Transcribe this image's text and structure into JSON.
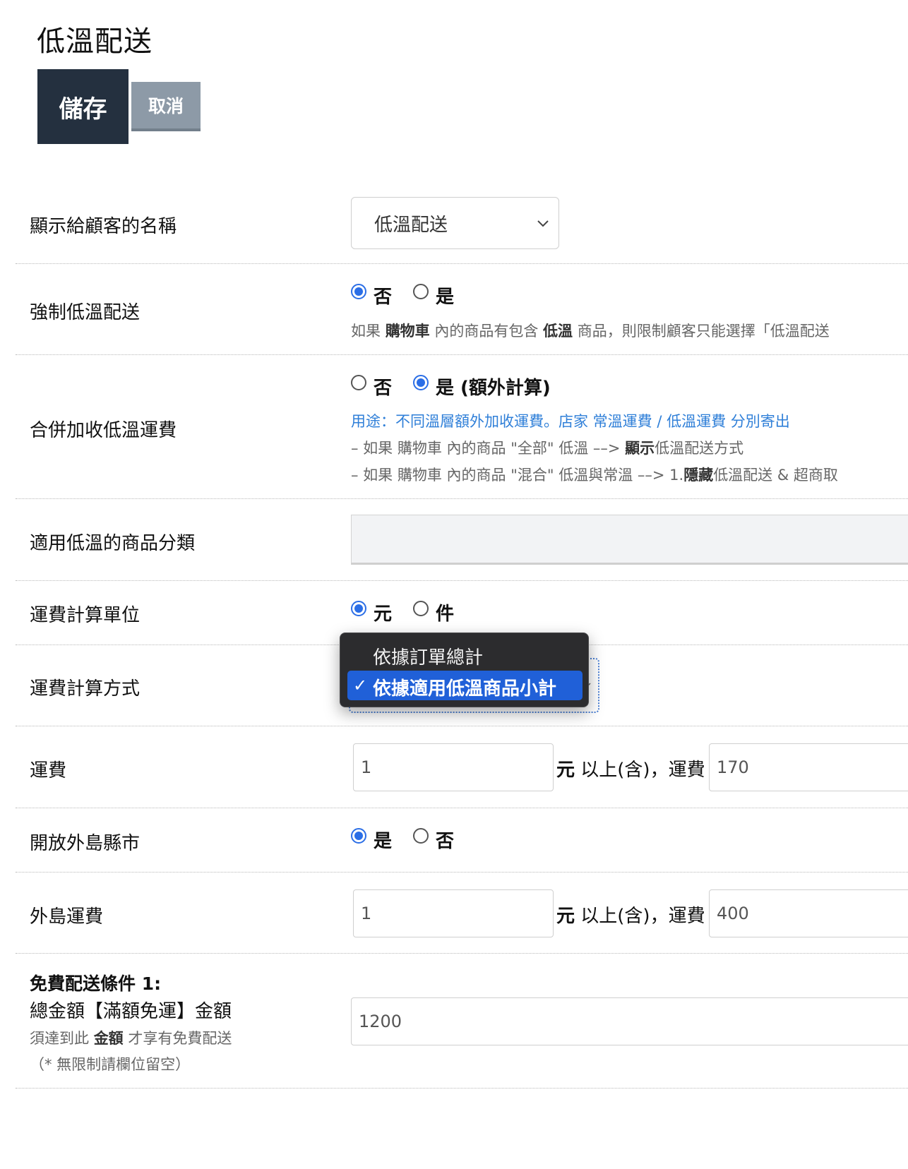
{
  "header": {
    "title": "低溫配送",
    "save_label": "儲存",
    "cancel_label": "取消"
  },
  "display_name": {
    "label": "顯示給顧客的名稱",
    "selected": "低溫配送"
  },
  "force_cold": {
    "label": "強制低溫配送",
    "options": [
      "否",
      "是"
    ],
    "selected": "否",
    "hint_pre": "如果 ",
    "hint_b1": "購物車",
    "hint_mid": " 內的商品有包含 ",
    "hint_b2": "低溫",
    "hint_post": " 商品，則限制顧客只能選擇「低溫配送"
  },
  "merge_fee": {
    "label": "合併加收低溫運費",
    "options": [
      "否",
      "是 (額外計算)"
    ],
    "selected": "是 (額外計算)",
    "purpose": "用途：不同溫層額外加收運費。店家 常溫運費 / 低溫運費 分別寄出",
    "line1_pre": "– 如果 購物車 內的商品 \"全部\" 低溫 ––> ",
    "line1_b": "顯示",
    "line1_post": "低溫配送方式",
    "line2_pre": "– 如果 購物車 內的商品 \"混合\" 低溫與常溫 ––> 1.",
    "line2_b": "隱藏",
    "line2_post": "低溫配送 & 超商取"
  },
  "categories": {
    "label": "適用低溫的商品分類"
  },
  "fee_unit": {
    "label": "運費計算單位",
    "options": [
      "元",
      "件"
    ],
    "selected": "元"
  },
  "fee_method": {
    "label": "運費計算方式",
    "options": [
      "依據訂單總計",
      "依據適用低溫商品小計"
    ],
    "selected": "依據適用低溫商品小計",
    "check": "✓"
  },
  "fee": {
    "label": "運費",
    "threshold": "1",
    "unit": "元",
    "mid": " 以上(含)，運費",
    "amount": "170"
  },
  "outer_island": {
    "label": "開放外島縣市",
    "options": [
      "是",
      "否"
    ],
    "selected": "是"
  },
  "outer_fee": {
    "label": "外島運費",
    "threshold": "1",
    "unit": "元",
    "mid": " 以上(含)，運費",
    "amount": "400"
  },
  "free_shipping": {
    "title": "免費配送條件 1:",
    "subtitle": "總金額【滿額免運】金額",
    "hint_pre": "須達到此 ",
    "hint_b": "金額",
    "hint_post": " 才享有免費配送",
    "note": "（* 無限制請欄位留空）",
    "value": "1200"
  },
  "colors": {
    "save_bg": "#24303f",
    "cancel_bg": "#8d9aa7",
    "radio_accent": "#2b6ee6",
    "hint_blue": "#2f7fd8",
    "dropdown_bg": "#2c2c2e",
    "dropdown_selected": "#2060d8"
  },
  "icons": {
    "select_chevron": "chevron-down-icon",
    "checkmark": "checkmark-icon"
  }
}
